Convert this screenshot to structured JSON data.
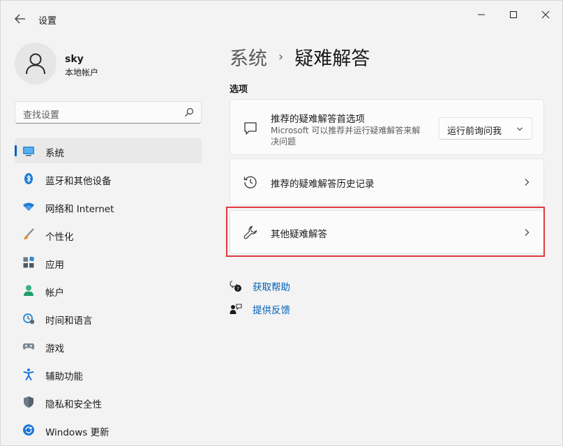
{
  "window": {
    "title": "设置",
    "back_icon": "back-arrow-icon",
    "controls": [
      "minimize-icon",
      "maximize-icon",
      "close-icon"
    ]
  },
  "profile": {
    "name": "sky",
    "account_type": "本地帐户"
  },
  "search": {
    "placeholder": "查找设置"
  },
  "sidebar": {
    "items": [
      {
        "label": "系统",
        "icon": "system-icon",
        "active": true
      },
      {
        "label": "蓝牙和其他设备",
        "icon": "bluetooth-icon"
      },
      {
        "label": "网络和 Internet",
        "icon": "network-icon"
      },
      {
        "label": "个性化",
        "icon": "personalization-icon"
      },
      {
        "label": "应用",
        "icon": "apps-icon"
      },
      {
        "label": "帐户",
        "icon": "accounts-icon"
      },
      {
        "label": "时间和语言",
        "icon": "time-language-icon"
      },
      {
        "label": "游戏",
        "icon": "gaming-icon"
      },
      {
        "label": "辅助功能",
        "icon": "accessibility-icon"
      },
      {
        "label": "隐私和安全性",
        "icon": "privacy-shield-icon"
      },
      {
        "label": "Windows 更新",
        "icon": "windows-update-icon"
      }
    ]
  },
  "main": {
    "breadcrumb_parent": "系统",
    "breadcrumb_separator": "›",
    "breadcrumb_current": "疑难解答",
    "section_label": "选项",
    "cards": {
      "recommended_prefs": {
        "title": "推荐的疑难解答首选项",
        "description": "Microsoft 可以推荐并运行疑难解答来解决问题",
        "dropdown_value": "运行前询问我",
        "icon": "chat-bubble-icon"
      },
      "recommended_history": {
        "title": "推荐的疑难解答历史记录",
        "icon": "history-icon"
      },
      "other_troubleshooters": {
        "title": "其他疑难解答",
        "icon": "wrench-icon"
      }
    },
    "links": {
      "get_help": "获取帮助",
      "give_feedback": "提供反馈"
    }
  },
  "colors": {
    "accent": "#005fb8",
    "highlight_border": "#e0393e",
    "background": "#f3f3f3"
  }
}
